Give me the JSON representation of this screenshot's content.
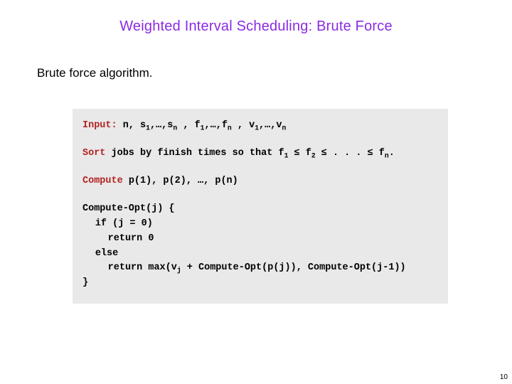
{
  "title": "Weighted Interval Scheduling:  Brute Force",
  "subtitle": "Brute force algorithm.",
  "code": {
    "input_kw": "Input:",
    "input_rest": " n, s",
    "sort_kw": "Sort",
    "sort_rest_a": " jobs by finish times so that f",
    "sort_rest_b": " . . . ",
    "compute_kw": "Compute",
    "compute_rest": " p(1), p(2), …, p(n)",
    "fn_head": "Compute-Opt(j) {",
    "if_kw": "if",
    "if_cond": " (j = 0)",
    "ret_kw": "return",
    "ret0_val": " 0",
    "else_kw": "else",
    "retmax_a": " max(v",
    "retmax_b": " + Compute-Opt(p(j)), Compute-Opt(j-1))",
    "brace_close": "}",
    "sub_1": "1",
    "sub_n": "n",
    "sub_2": "2",
    "sub_j": "j",
    "ell": ",…,",
    "comma_sp": " , ",
    "s": "s",
    "f": "f",
    "v": "v",
    "le": " ≤ ",
    "le2": " ≤",
    "fchar": " f",
    "period": "."
  },
  "page_number": "10"
}
